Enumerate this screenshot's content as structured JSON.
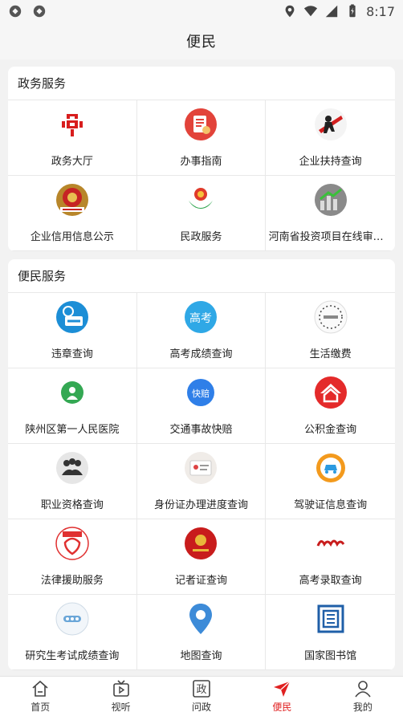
{
  "status_bar": {
    "time": "8:17"
  },
  "header": {
    "title": "便民"
  },
  "sections": [
    {
      "title": "政务服务",
      "items": [
        {
          "label": "政务大厅",
          "icon": "bank-logo-icon"
        },
        {
          "label": "办事指南",
          "icon": "guide-document-icon"
        },
        {
          "label": "企业扶持查询",
          "icon": "enterprise-support-icon"
        },
        {
          "label": "企业信用信息公示",
          "icon": "national-emblem-icon"
        },
        {
          "label": "民政服务",
          "icon": "civil-affairs-icon"
        },
        {
          "label": "河南省投资项目在线审批…",
          "icon": "investment-project-icon"
        }
      ]
    },
    {
      "title": "便民服务",
      "items": [
        {
          "label": "违章查询",
          "icon": "traffic-violation-icon"
        },
        {
          "label": "高考成绩查询",
          "icon": "gaokao-icon",
          "icon_text": "高考"
        },
        {
          "label": "生活缴费",
          "icon": "utility-payment-icon"
        },
        {
          "label": "陕州区第一人民医院",
          "icon": "hospital-icon"
        },
        {
          "label": "交通事故快赔",
          "icon": "accident-claim-icon",
          "icon_text": "快赔"
        },
        {
          "label": "公积金查询",
          "icon": "housing-fund-icon"
        },
        {
          "label": "职业资格查询",
          "icon": "professional-qualification-icon"
        },
        {
          "label": "身份证办理进度查询",
          "icon": "id-card-icon"
        },
        {
          "label": "驾驶证信息查询",
          "icon": "driver-license-icon"
        },
        {
          "label": "法律援助服务",
          "icon": "legal-aid-icon"
        },
        {
          "label": "记者证查询",
          "icon": "press-card-icon"
        },
        {
          "label": "高考录取查询",
          "icon": "admission-query-icon"
        },
        {
          "label": "研究生考试成绩查询",
          "icon": "graduate-exam-icon"
        },
        {
          "label": "地图查询",
          "icon": "map-pin-icon"
        },
        {
          "label": "国家图书馆",
          "icon": "national-library-icon"
        }
      ]
    }
  ],
  "tabs": [
    {
      "label": "首页",
      "icon": "home-icon"
    },
    {
      "label": "视听",
      "icon": "tv-play-icon"
    },
    {
      "label": "问政",
      "icon": "zheng-badge-icon",
      "icon_text": "政"
    },
    {
      "label": "便民",
      "icon": "paper-plane-icon",
      "active": true
    },
    {
      "label": "我的",
      "icon": "user-icon"
    }
  ],
  "colors": {
    "accent_red": "#e02020",
    "tab_inactive": "#333333",
    "background": "#f2f2f2"
  }
}
